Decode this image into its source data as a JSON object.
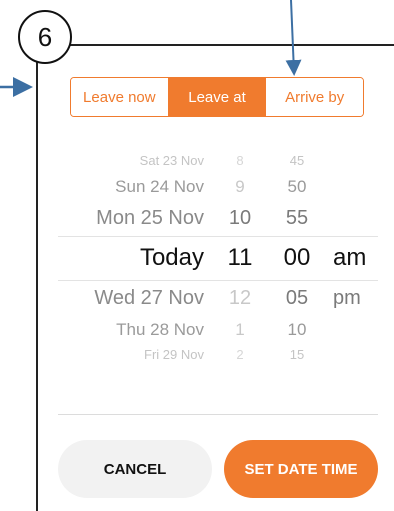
{
  "step_badge": "6",
  "mode_tabs": [
    {
      "label": "Leave now",
      "active": false
    },
    {
      "label": "Leave at",
      "active": true
    },
    {
      "label": "Arrive by",
      "active": false
    }
  ],
  "picker": {
    "day_column": [
      "Sat 23 Nov",
      "Sun 24 Nov",
      "Mon 25 Nov",
      "Today",
      "Wed 27 Nov",
      "Thu 28 Nov",
      "Fri 29 Nov"
    ],
    "hour_column": [
      "8",
      "9",
      "10",
      "11",
      "12",
      "1",
      "2"
    ],
    "minute_column": [
      "45",
      "50",
      "55",
      "00",
      "05",
      "10",
      "15"
    ],
    "ampm_column": [
      "am",
      "pm"
    ],
    "selected": {
      "day": "Today",
      "hour": "11",
      "minute": "00",
      "ampm": "am"
    }
  },
  "buttons": {
    "cancel": "CANCEL",
    "set": "SET DATE TIME"
  },
  "colors": {
    "accent": "#f07b2e",
    "annotation_arrow": "#3c6fa3"
  },
  "icons": [
    "annotation-arrow-icon"
  ]
}
